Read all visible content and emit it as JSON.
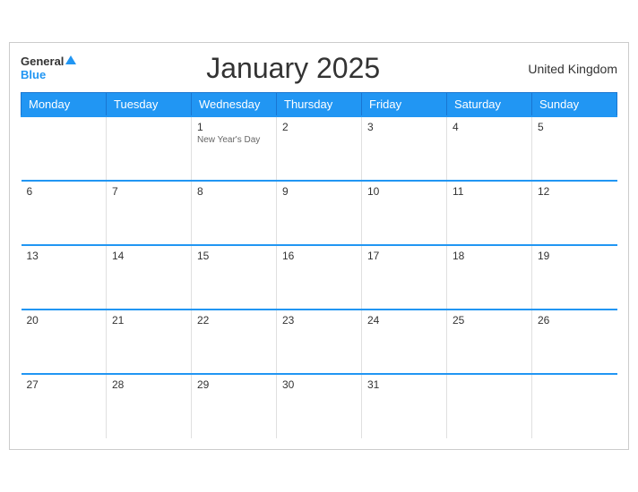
{
  "header": {
    "logo_general": "General",
    "logo_blue": "Blue",
    "month_title": "January 2025",
    "region": "United Kingdom"
  },
  "days_of_week": [
    "Monday",
    "Tuesday",
    "Wednesday",
    "Thursday",
    "Friday",
    "Saturday",
    "Sunday"
  ],
  "weeks": [
    [
      {
        "num": "",
        "event": "",
        "empty": true
      },
      {
        "num": "",
        "event": "",
        "empty": true
      },
      {
        "num": "1",
        "event": "New Year's Day",
        "empty": false
      },
      {
        "num": "2",
        "event": "",
        "empty": false
      },
      {
        "num": "3",
        "event": "",
        "empty": false
      },
      {
        "num": "4",
        "event": "",
        "empty": false
      },
      {
        "num": "5",
        "event": "",
        "empty": false
      }
    ],
    [
      {
        "num": "6",
        "event": "",
        "empty": false
      },
      {
        "num": "7",
        "event": "",
        "empty": false
      },
      {
        "num": "8",
        "event": "",
        "empty": false
      },
      {
        "num": "9",
        "event": "",
        "empty": false
      },
      {
        "num": "10",
        "event": "",
        "empty": false
      },
      {
        "num": "11",
        "event": "",
        "empty": false
      },
      {
        "num": "12",
        "event": "",
        "empty": false
      }
    ],
    [
      {
        "num": "13",
        "event": "",
        "empty": false
      },
      {
        "num": "14",
        "event": "",
        "empty": false
      },
      {
        "num": "15",
        "event": "",
        "empty": false
      },
      {
        "num": "16",
        "event": "",
        "empty": false
      },
      {
        "num": "17",
        "event": "",
        "empty": false
      },
      {
        "num": "18",
        "event": "",
        "empty": false
      },
      {
        "num": "19",
        "event": "",
        "empty": false
      }
    ],
    [
      {
        "num": "20",
        "event": "",
        "empty": false
      },
      {
        "num": "21",
        "event": "",
        "empty": false
      },
      {
        "num": "22",
        "event": "",
        "empty": false
      },
      {
        "num": "23",
        "event": "",
        "empty": false
      },
      {
        "num": "24",
        "event": "",
        "empty": false
      },
      {
        "num": "25",
        "event": "",
        "empty": false
      },
      {
        "num": "26",
        "event": "",
        "empty": false
      }
    ],
    [
      {
        "num": "27",
        "event": "",
        "empty": false
      },
      {
        "num": "28",
        "event": "",
        "empty": false
      },
      {
        "num": "29",
        "event": "",
        "empty": false
      },
      {
        "num": "30",
        "event": "",
        "empty": false
      },
      {
        "num": "31",
        "event": "",
        "empty": false
      },
      {
        "num": "",
        "event": "",
        "empty": true
      },
      {
        "num": "",
        "event": "",
        "empty": true
      }
    ]
  ]
}
